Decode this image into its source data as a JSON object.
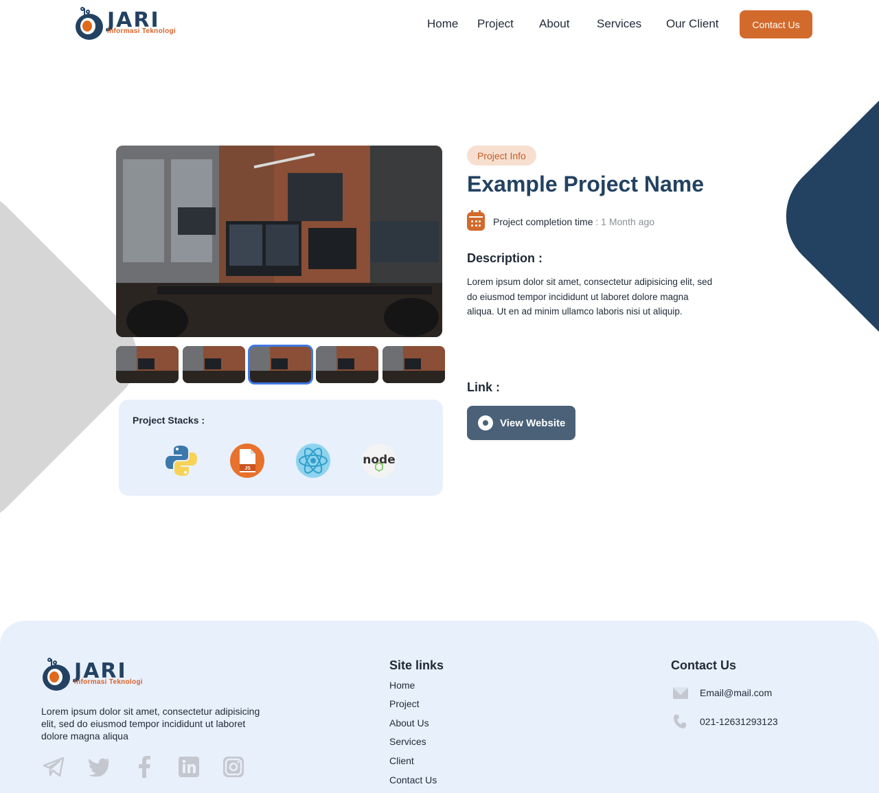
{
  "brand": {
    "name": "JARI",
    "tagline": "Informasi Teknologi"
  },
  "nav": {
    "items": [
      "Home",
      "Project",
      "About",
      "Services",
      "Our Client"
    ],
    "cta": "Contact Us"
  },
  "project": {
    "badge": "Project Info",
    "title": "Example Project Name",
    "completion_label": "Project completion time",
    "completion_value": ": 1 Month ago",
    "description_heading": "Description :",
    "description": "Lorem ipsum dolor sit amet, consectetur adipisicing elit, sed do eiusmod tempor incididunt ut laboret dolore magna aliqua. Ut en ad minim ullamco laboris nisi ut aliquip.",
    "link_heading": "Link :",
    "view_button": "View Website",
    "selected_thumbnail": 3
  },
  "stacks": {
    "title": "Project Stacks :",
    "icons": [
      "python-icon",
      "javascript-file-icon",
      "react-icon",
      "nodejs-icon"
    ]
  },
  "footer": {
    "about": "Lorem ipsum dolor sit amet, consectetur adipisicing elit, sed do eiusmod tempor incididunt ut laboret dolore magna aliqua",
    "social_icons": [
      "telegram-icon",
      "twitter-icon",
      "facebook-icon",
      "linkedin-icon",
      "instagram-icon"
    ],
    "site_links_heading": "Site links",
    "site_links": [
      "Home",
      "Project",
      "About Us",
      "Services",
      "Client",
      "Contact Us"
    ],
    "contact_heading": "Contact Us",
    "email": "Email@mail.com",
    "phone": "021-12631293123"
  },
  "colors": {
    "accent": "#d26a2c",
    "navy": "#234262",
    "thumbnail_highlight": "#3f78e0",
    "footer_bg": "#e8f0fc"
  }
}
